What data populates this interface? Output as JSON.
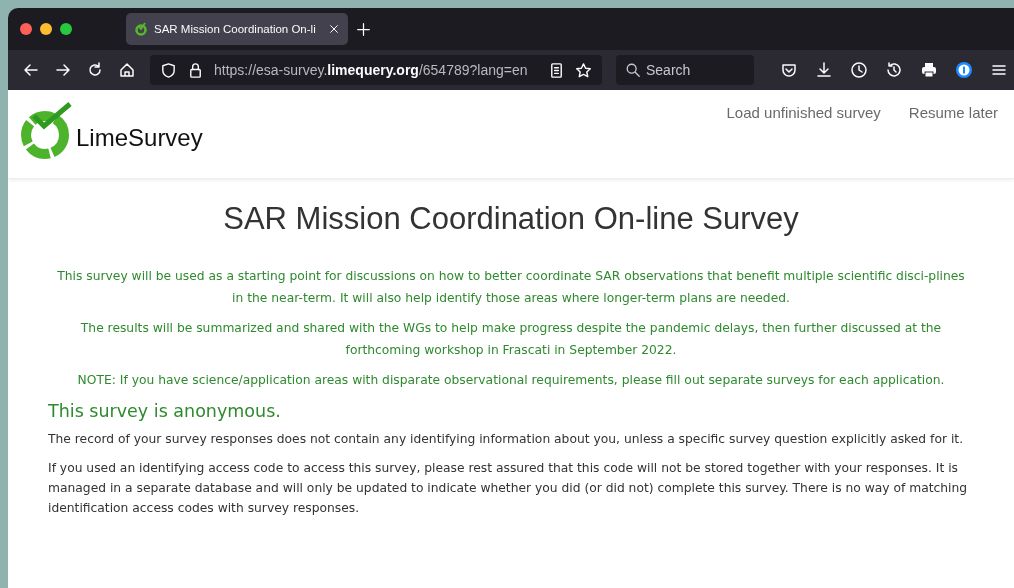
{
  "window_buttons": [
    {
      "color": "#fe5f57"
    },
    {
      "color": "#febc2e"
    },
    {
      "color": "#28c840"
    }
  ],
  "tabs": [
    {
      "title": "SAR Mission Coordination On-li",
      "selected": true
    }
  ],
  "toolbar": {
    "url": "https://esa-survey.**limequery.org**/654789?lang=en",
    "search": {
      "placeholder": "Search"
    }
  },
  "header": {
    "logo": "LimeSurvey",
    "links": [
      "Load unfinished survey",
      "Resume later"
    ]
  },
  "survey": {
    "title": "SAR Mission Coordination On-line Survey",
    "intro": [
      "This survey will be used as a starting point for discussions on how to better coordinate SAR observations that benefit multiple scientific disci-plines in the near-term.  It will also help identify those areas where longer-term plans are needed.",
      "The results will be summarized and shared with the WGs to help make progress despite the pandemic delays, then further discussed at the forthcoming workshop in Frascati in September 2022.",
      "NOTE: If you have science/application areas with disparate observational requirements, please fill out separate surveys for each application."
    ],
    "privacy_heading": "This survey is anonymous.",
    "privacy": [
      "The record of your survey responses does not contain any identifying information about you, unless a specific survey question explicitly asked for it.",
      "If you used an identifying access code to access this survey, please rest assured that this code will not be stored together with your responses. It is managed in a separate database and will only be updated to indicate whether you did (or did not) complete this survey. There is no way of matching identification access codes with survey responses."
    ]
  }
}
